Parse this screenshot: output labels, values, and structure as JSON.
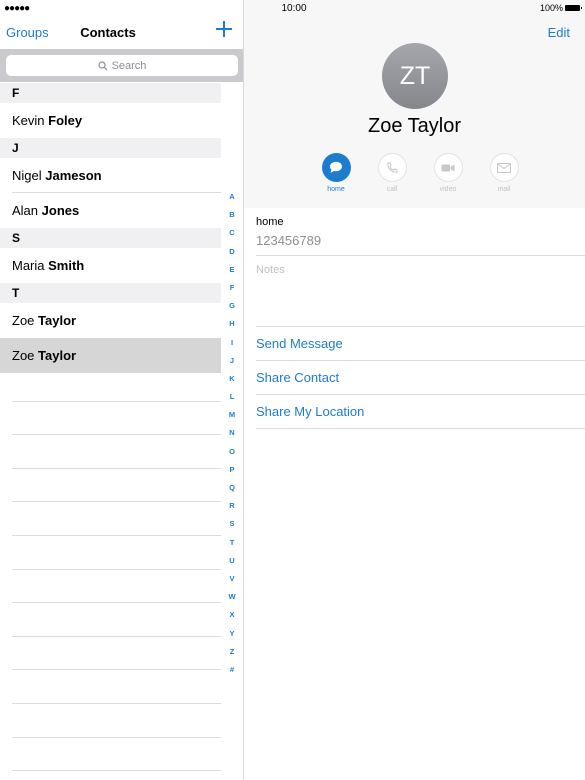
{
  "status_bar": {
    "signal": "●●●●●",
    "time": "10:00",
    "battery": "100%"
  },
  "contacts_nav": {
    "groups_label": "Groups",
    "title": "Contacts",
    "add_icon": "plus-icon"
  },
  "search": {
    "placeholder": "Search"
  },
  "sections": [
    {
      "letter": "F",
      "rows": [
        {
          "first": "Kevin",
          "last": "Foley"
        }
      ]
    },
    {
      "letter": "J",
      "rows": [
        {
          "first": "Nigel",
          "last": "Jameson"
        },
        {
          "first": "Alan",
          "last": "Jones"
        }
      ]
    },
    {
      "letter": "S",
      "rows": [
        {
          "first": "Maria",
          "last": "Smith"
        }
      ]
    },
    {
      "letter": "T",
      "rows": [
        {
          "first": "Zoe",
          "last": "Taylor"
        },
        {
          "first": "Zoe",
          "last": "Taylor",
          "selected": true
        }
      ]
    }
  ],
  "index_letters": [
    "A",
    "B",
    "C",
    "D",
    "E",
    "F",
    "G",
    "H",
    "I",
    "J",
    "K",
    "L",
    "M",
    "N",
    "O",
    "P",
    "Q",
    "R",
    "S",
    "T",
    "U",
    "V",
    "W",
    "X",
    "Y",
    "Z",
    "#"
  ],
  "detail": {
    "edit_label": "Edit",
    "initials": "ZT",
    "name": "Zoe Taylor",
    "actions": [
      {
        "label": "home",
        "icon": "message-icon",
        "active": true
      },
      {
        "label": "call",
        "icon": "phone-icon",
        "active": false
      },
      {
        "label": "video",
        "icon": "video-icon",
        "active": false
      },
      {
        "label": "mail",
        "icon": "mail-icon",
        "active": false
      }
    ],
    "phone_label": "home",
    "phone_value": "123456789",
    "notes_placeholder": "Notes",
    "send_message": "Send Message",
    "share_contact": "Share Contact",
    "share_location": "Share My Location"
  },
  "colors": {
    "accent": "#1e7ccf",
    "selected_row": "#d6d6d6",
    "section_bg": "#f0f0f2",
    "search_bar_bg": "#c9c9ce"
  }
}
